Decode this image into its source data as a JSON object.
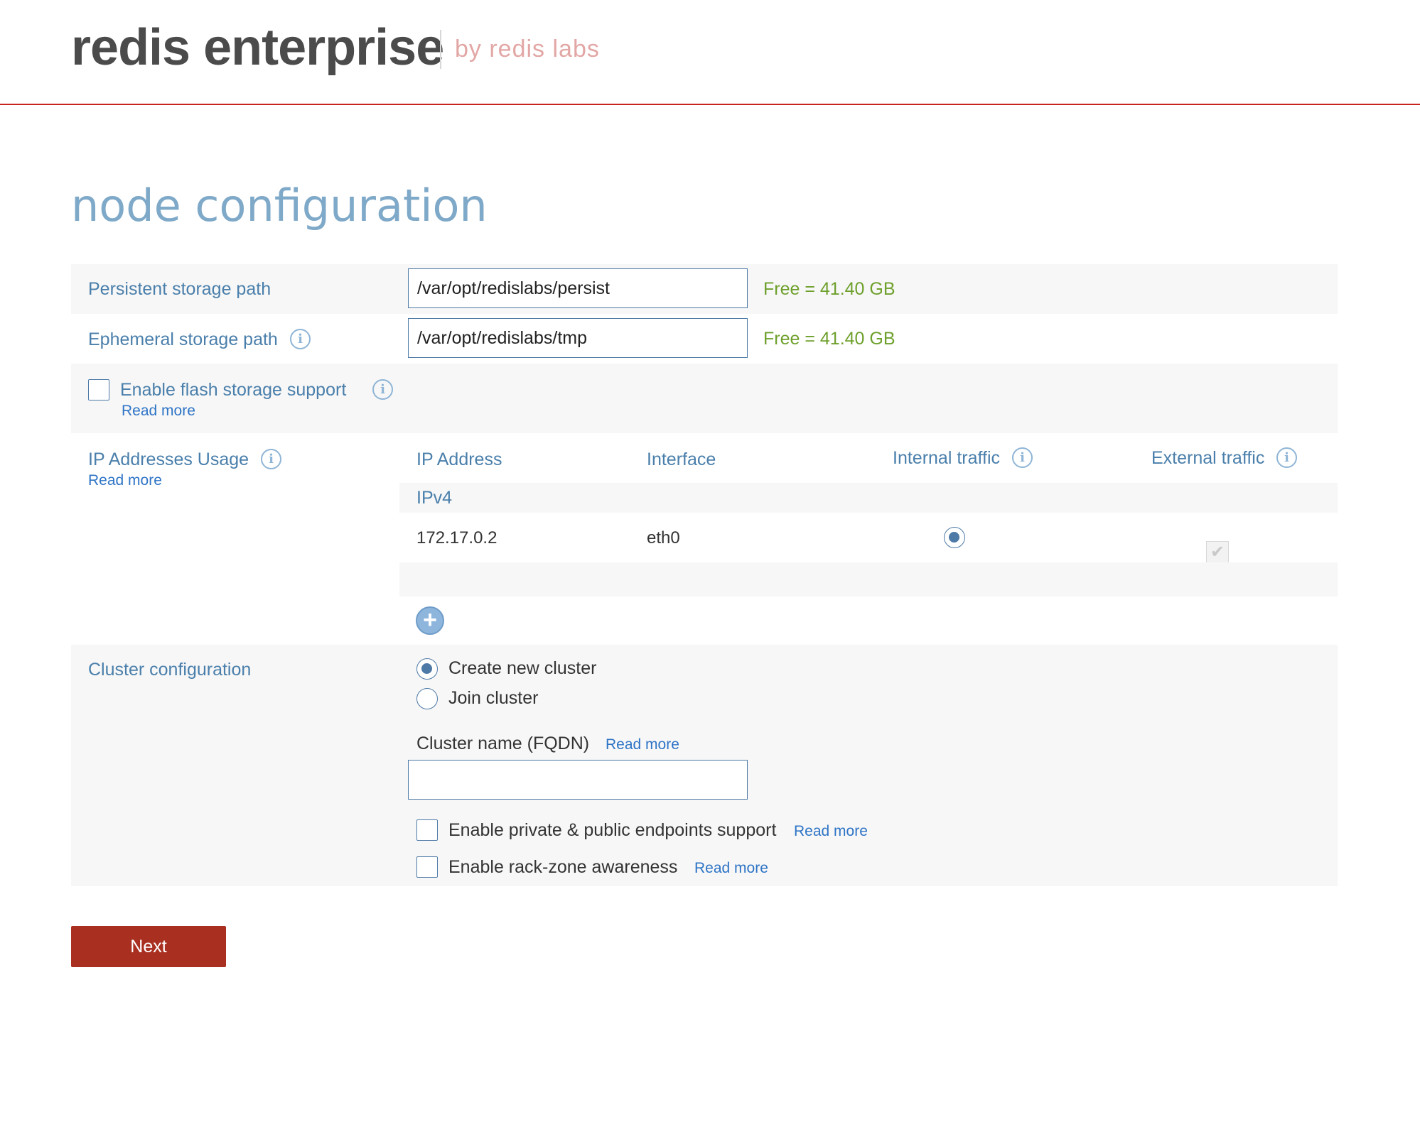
{
  "header": {
    "brand": "redis enterprise",
    "sub_brand": "by redis labs",
    "accent_color": "#c9231d"
  },
  "page_title": "node configuration",
  "storage": {
    "persistent": {
      "label": "Persistent storage path",
      "value": "/var/opt/redislabs/persist",
      "free": "Free = 41.40 GB"
    },
    "ephemeral": {
      "label": "Ephemeral storage path",
      "value": "/var/opt/redislabs/tmp",
      "free": "Free = 41.40 GB",
      "icon": "info-icon"
    }
  },
  "flash": {
    "label": "Enable flash storage support",
    "read_more": "Read more",
    "checked": false,
    "icon": "info-icon"
  },
  "ip_usage": {
    "label": "IP Addresses Usage",
    "read_more": "Read more",
    "columns": {
      "ip_address": "IP Address",
      "interface": "Interface",
      "internal": "Internal traffic",
      "external": "External traffic"
    },
    "group": "IPv4",
    "rows": [
      {
        "ip": "172.17.0.2",
        "interface": "eth0",
        "internal": true,
        "external": true
      }
    ],
    "add_icon": "plus-icon"
  },
  "cluster": {
    "label": "Cluster configuration",
    "options": [
      {
        "label": "Create new cluster",
        "selected": true
      },
      {
        "label": "Join cluster",
        "selected": false
      }
    ],
    "name_label": "Cluster name (FQDN)",
    "name_read_more": "Read more",
    "name_value": "",
    "endpoints": {
      "label": "Enable private & public endpoints support",
      "read_more": "Read more",
      "checked": false
    },
    "rack_zone": {
      "label": "Enable rack-zone awareness",
      "read_more": "Read more",
      "checked": false
    }
  },
  "next_button": "Next",
  "colors": {
    "label_blue": "#4a7fab",
    "free_green": "#6ea02c",
    "link_blue": "#2e74c6",
    "button_red": "#a93021"
  }
}
